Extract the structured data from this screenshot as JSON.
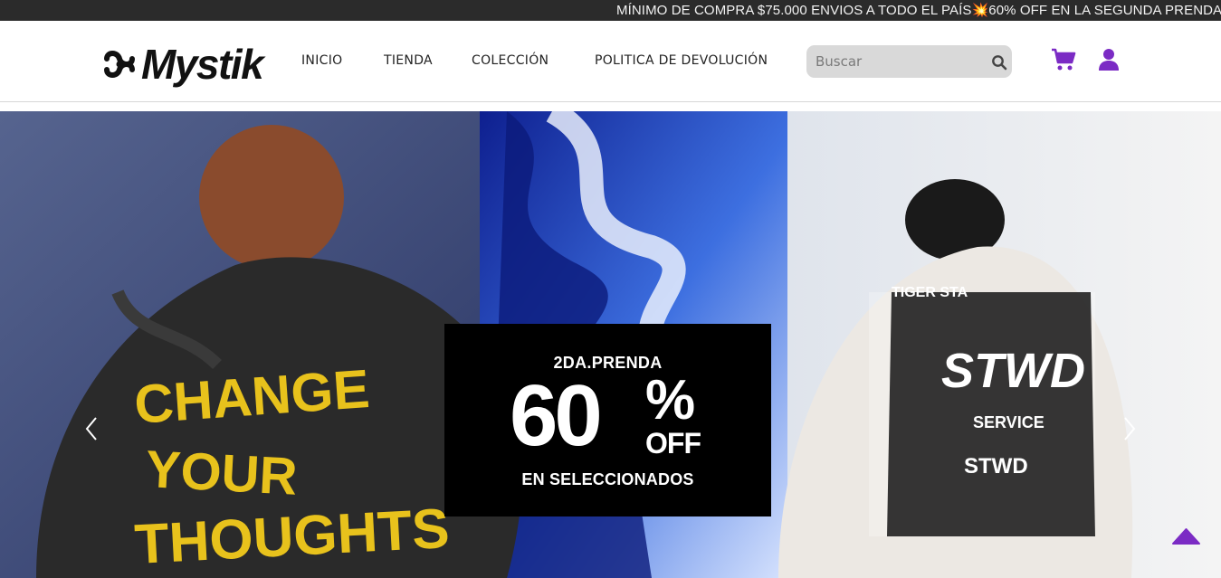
{
  "announcement": {
    "text": "MÍNIMO DE COMPRA $75.000 ENVIOS A TODO EL PAÍS💥60% OFF EN LA SEGUNDA PRENDA"
  },
  "header": {
    "logo_text": "Mystik",
    "nav": [
      {
        "label": "INICIO"
      },
      {
        "label": "TIENDA"
      },
      {
        "label": "COLECCIÓN"
      },
      {
        "label": "POLITICA DE DEVOLUCIÓN"
      }
    ],
    "search": {
      "placeholder": "Buscar",
      "value": ""
    },
    "icons": [
      "search-icon",
      "cart-icon",
      "user-icon"
    ]
  },
  "hero": {
    "promo": {
      "top_line": "2DA.PRENDA",
      "big_number": "60",
      "percent": "%",
      "off": "OFF",
      "bottom_line": "EN SELECCIONADOS"
    },
    "left_hoodie_text": [
      "CHANGE",
      "YOUR",
      "THOUGHTS"
    ],
    "right_hoodie_text": [
      "TIGER STA",
      "SERVICE",
      "STWD",
      "STWD"
    ],
    "controls": [
      "chevron-left-icon",
      "chevron-right-icon",
      "scroll-top-icon"
    ]
  },
  "colors": {
    "accent": "#7b2bc4",
    "announce_bg": "#2b2b2b",
    "promo_bg": "#000000",
    "search_bg": "#d9d9d9"
  }
}
